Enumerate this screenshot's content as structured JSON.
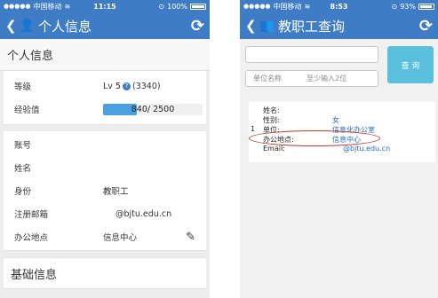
{
  "left_phone": {
    "status": {
      "carrier": "中国移动",
      "time": "11:15",
      "battery": "100%"
    },
    "nav": {
      "title": "个人信息"
    },
    "section_personal": "个人信息",
    "level": {
      "label": "等级",
      "value": "Lv 5",
      "points": "(3340)"
    },
    "exp": {
      "label": "经验值",
      "text": "840/ 2500",
      "progress": 0.336
    },
    "fields": [
      {
        "label": "账号",
        "value": ""
      },
      {
        "label": "姓名",
        "value": ""
      },
      {
        "label": "身份",
        "value": "教职工"
      },
      {
        "label": "注册邮箱",
        "value": "@bjtu.edu.cn"
      },
      {
        "label": "办公地点",
        "value": "信息中心"
      }
    ],
    "section_basic": "基础信息"
  },
  "right_phone": {
    "status": {
      "carrier": "中国移动",
      "time": "8:53",
      "battery": "93%"
    },
    "nav": {
      "title": "教职工查询"
    },
    "search": {
      "unit_placeholder": "单位名称",
      "min_chars": "至少输入2位",
      "button": "查 询"
    },
    "result": {
      "index": "1",
      "rows": [
        {
          "label": "姓名:",
          "value": ""
        },
        {
          "label": "性别:",
          "value": "女"
        },
        {
          "label": "单位:",
          "value": "信息化办公室"
        },
        {
          "label": "办公地点:",
          "value": "信息中心"
        },
        {
          "label": "Email:",
          "value": "@bjtu.edu.cn"
        }
      ]
    }
  }
}
